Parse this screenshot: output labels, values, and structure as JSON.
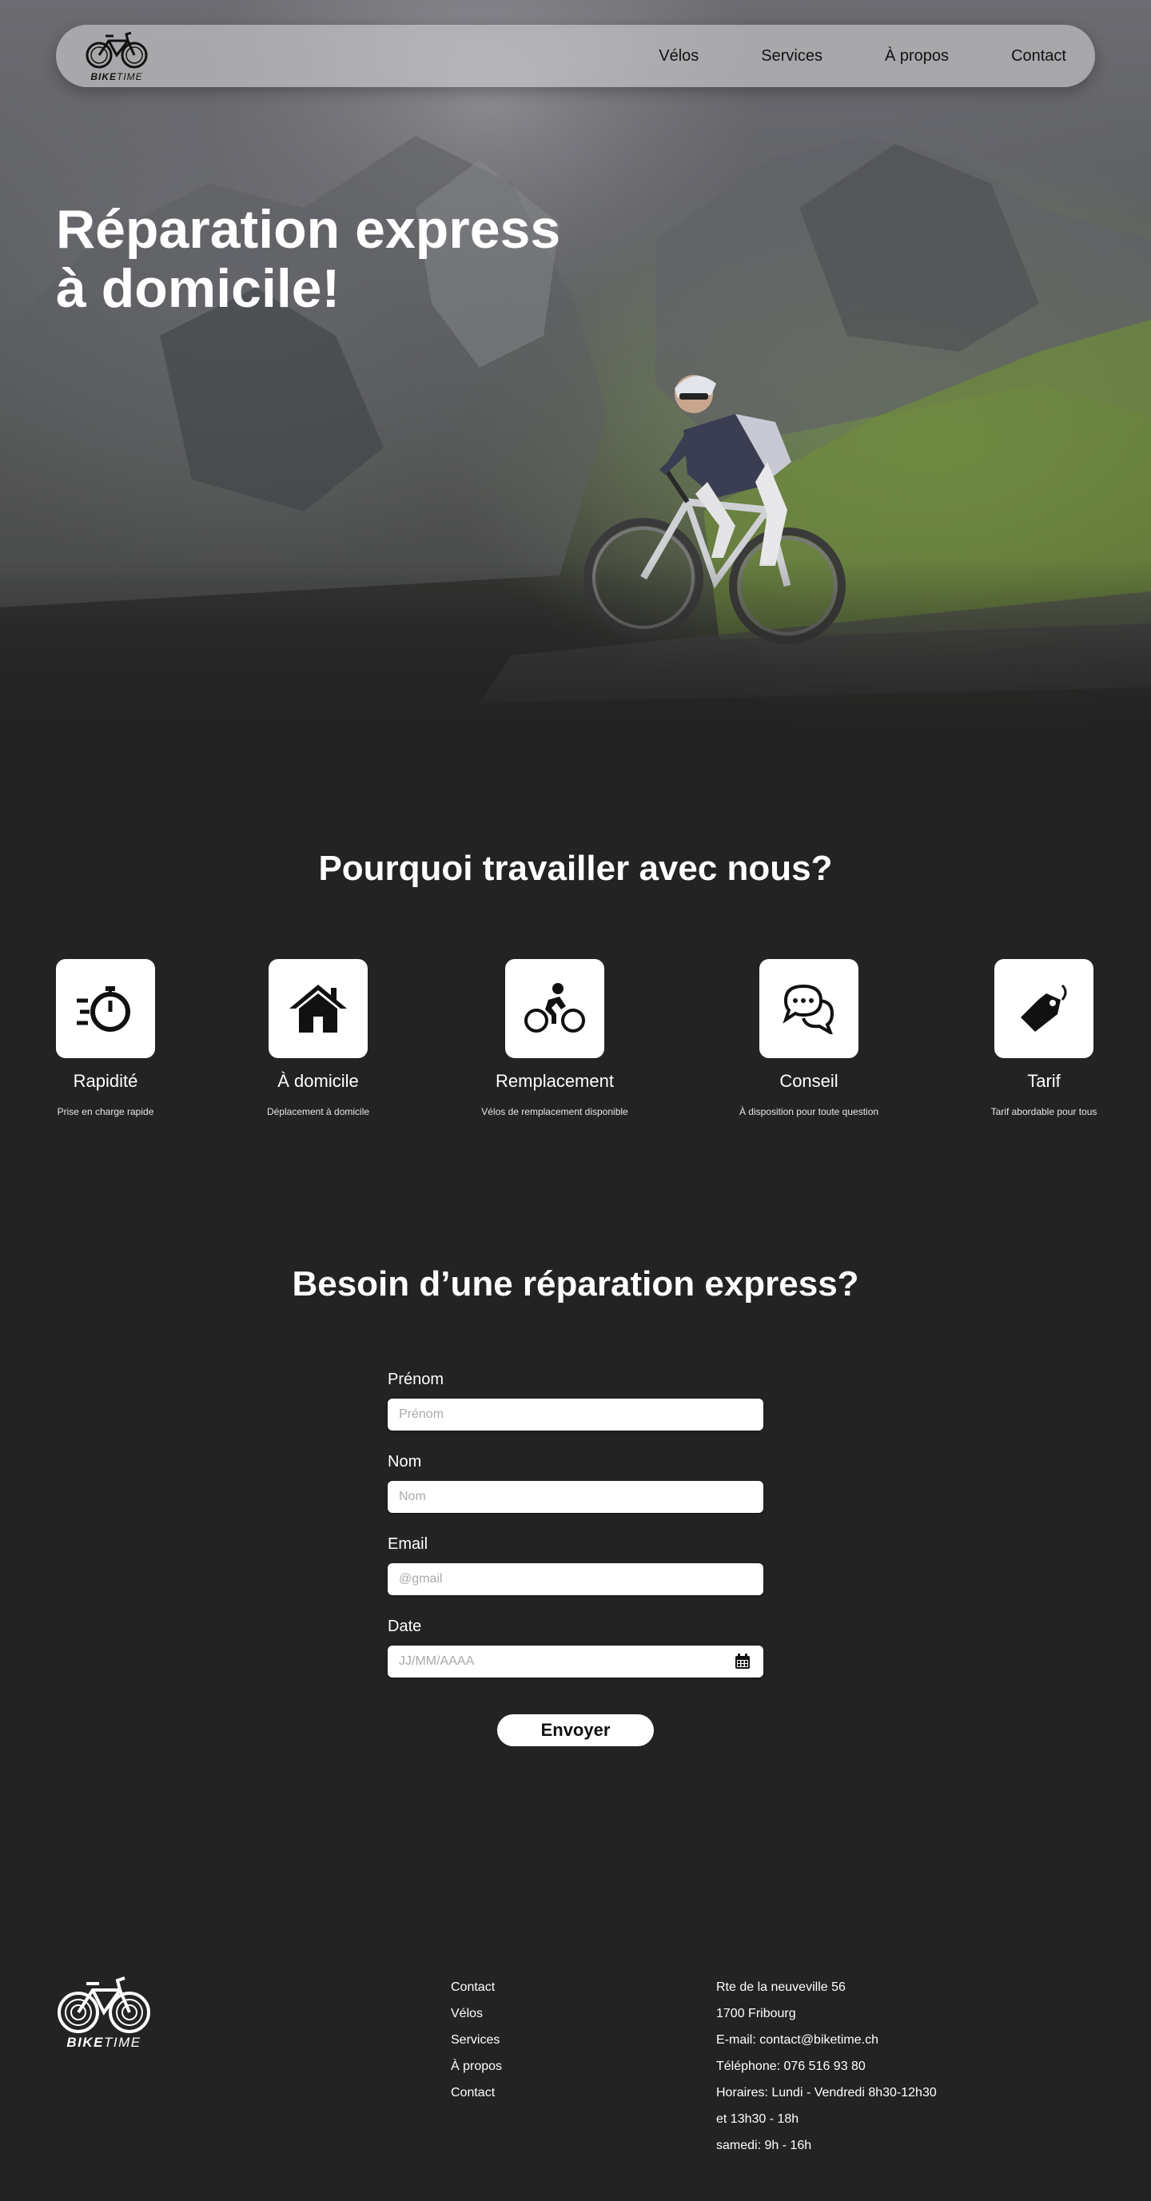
{
  "brand": {
    "name_bold": "BIKE",
    "name_light": "TIME"
  },
  "nav": {
    "items": [
      {
        "label": "Vélos"
      },
      {
        "label": "Services"
      },
      {
        "label": "À propos"
      },
      {
        "label": "Contact"
      }
    ]
  },
  "hero": {
    "title_line1": "Réparation express",
    "title_line2": "à domicile!"
  },
  "why": {
    "title": "Pourquoi travailler avec nous?",
    "features": [
      {
        "icon": "stopwatch-icon",
        "name": "Rapidité",
        "desc": "Prise en charge rapide"
      },
      {
        "icon": "house-icon",
        "name": "À domicile",
        "desc": "Déplacement à domicile"
      },
      {
        "icon": "cyclist-icon",
        "name": "Remplacement",
        "desc": "Vélos de remplacement disponible"
      },
      {
        "icon": "chat-bubbles-icon",
        "name": "Conseil",
        "desc": "À disposition pour toute question"
      },
      {
        "icon": "price-tag-icon",
        "name": "Tarif",
        "desc": "Tarif abordable pour tous"
      }
    ]
  },
  "form": {
    "title": "Besoin d’une réparation express?",
    "fields": [
      {
        "label": "Prénom",
        "placeholder": "Prénom",
        "value": ""
      },
      {
        "label": "Nom",
        "placeholder": "Nom",
        "value": ""
      },
      {
        "label": "Email",
        "placeholder": "@gmail",
        "value": ""
      },
      {
        "label": "Date",
        "placeholder": "JJ/MM/AAAA",
        "value": "",
        "icon": "calendar-icon"
      }
    ],
    "submit_label": "Envoyer"
  },
  "footer": {
    "links": [
      {
        "label": "Contact"
      },
      {
        "label": "Vélos"
      },
      {
        "label": "Services"
      },
      {
        "label": "À propos"
      },
      {
        "label": "Contact"
      }
    ],
    "info": [
      "Rte de la neuveville 56",
      "1700 Fribourg",
      "E-mail: contact@biketime.ch",
      "Téléphone: 076 516 93 80",
      "Horaires: Lundi - Vendredi 8h30-12h30",
      "et 13h30 - 18h",
      "samedi: 9h - 16h"
    ]
  },
  "colors": {
    "background": "#232323",
    "text": "#ffffff",
    "card": "#ffffff",
    "icon": "#111111"
  }
}
